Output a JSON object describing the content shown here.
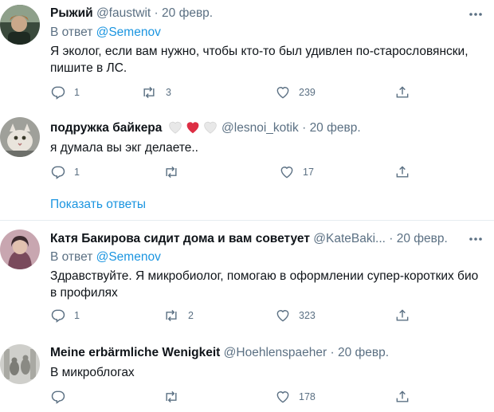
{
  "tweets": [
    {
      "name": "Рыжий",
      "handle": "@faustwit",
      "separator": "·",
      "date": "20 февр.",
      "reply_prefix": "В ответ",
      "reply_to": "@Semenov",
      "text": "Я эколог, если вам нужно, чтобы кто-то был удивлен по-старословянски, пишите в ЛС.",
      "replies": "1",
      "retweets": "3",
      "likes": "239"
    },
    {
      "name": "подружка байкера",
      "handle": "@lesnoi_kotik",
      "separator": "·",
      "date": "20 февр.",
      "text": "я думала вы экг делаете..",
      "replies": "1",
      "retweets": "",
      "likes": "17",
      "show_replies": "Показать ответы"
    },
    {
      "name": "Катя Бакирова сидит дома и вам советует",
      "handle": "@KateBaki...",
      "separator": "·",
      "date": "20 февр.",
      "reply_prefix": "В ответ",
      "reply_to": "@Semenov",
      "text": "Здравствуйте. Я микробиолог, помогаю в оформлении супер-коротких био в профилях",
      "replies": "1",
      "retweets": "2",
      "likes": "323"
    },
    {
      "name": "Meine erbärmliche Wenigkeit",
      "handle": "@Hoehlenspaeher",
      "separator": "·",
      "date": "20 февр.",
      "text": "В микроблогах",
      "replies": "",
      "retweets": "",
      "likes": "178"
    }
  ],
  "colors": {
    "text": "#0f1419",
    "muted": "#5b7083",
    "link": "#1b95e0",
    "divider": "#e6ecf0",
    "heart": "#e0245e"
  }
}
